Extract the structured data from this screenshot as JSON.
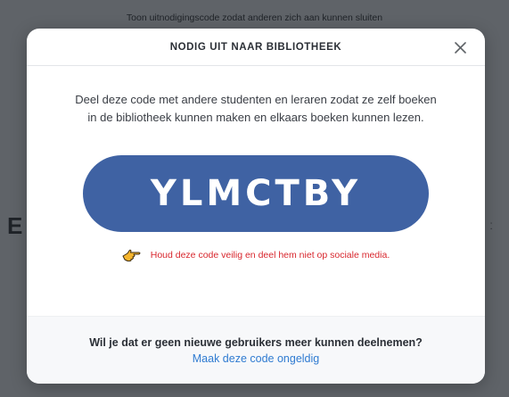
{
  "background": {
    "top_text": "Toon uitnodigingscode zodat anderen zich aan kunnen sluiten",
    "left_letter": "E",
    "right_mark": "ː"
  },
  "modal": {
    "title": "NODIG UIT NAAR BIBLIOTHEEK",
    "close_icon": "close-icon",
    "description": "Deel deze code met andere studenten en leraren zodat ze zelf boeken in de bibliotheek kunnen maken en elkaars boeken kunnen lezen.",
    "invite_code": "YLMCTBY",
    "warning_icon": "pointing-hand-icon",
    "warning_text": "Houd deze code veilig en deel hem niet op sociale media.",
    "footer_question": "Wil je dat er geen nieuwe gebruikers meer kunnen deelnemen?",
    "footer_link": "Maak deze code ongeldig"
  },
  "colors": {
    "overlay": "#5f6368",
    "code_background": "#3f62a3",
    "warning": "#d8262d",
    "link": "#2f7bd1"
  }
}
